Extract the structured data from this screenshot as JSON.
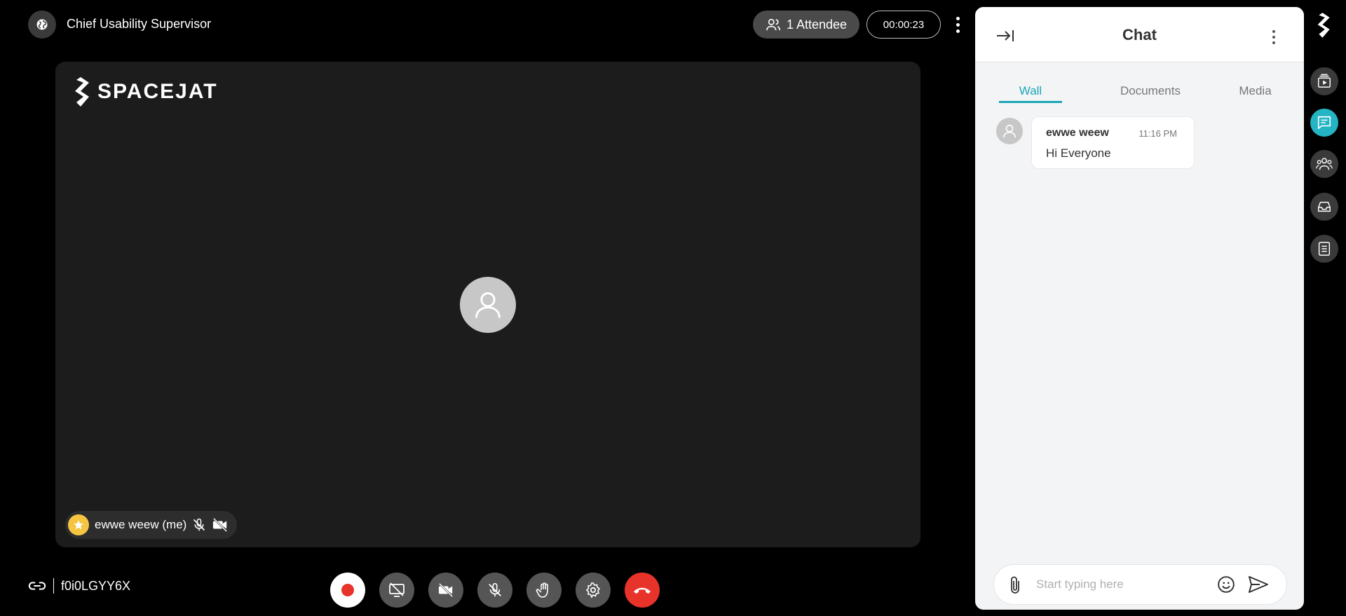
{
  "header": {
    "meeting_title": "Chief Usability Supervisor",
    "attendee_label": "1 Attendee",
    "timer": "00:00:23"
  },
  "stage": {
    "logo_text": "SPACEJAT",
    "participant_name": "ewwe weew (me)"
  },
  "footer": {
    "meeting_code": "f0i0LGYY6X"
  },
  "chat": {
    "title": "Chat",
    "tabs": [
      {
        "label": "Wall",
        "active": true
      },
      {
        "label": "Documents",
        "active": false
      },
      {
        "label": "Media",
        "active": false
      }
    ],
    "messages": [
      {
        "author": "ewwe weew",
        "time": "11:16 PM",
        "text": "Hi Everyone"
      }
    ],
    "composer_placeholder": "Start typing here"
  },
  "colors": {
    "accent": "#24b4c4",
    "end_call": "#e8332a",
    "host_badge": "#f5c542"
  },
  "icons": {
    "top": [
      "globe-icon",
      "people-icon",
      "more-vertical-icon"
    ],
    "controls": [
      "record-icon",
      "screen-share-off-icon",
      "video-off-icon",
      "mic-off-icon",
      "raise-hand-icon",
      "settings-icon",
      "end-call-icon"
    ],
    "rail": [
      "brand-logo-icon",
      "playlist-icon",
      "chat-icon",
      "participants-icon",
      "inbox-icon",
      "notes-icon"
    ]
  }
}
